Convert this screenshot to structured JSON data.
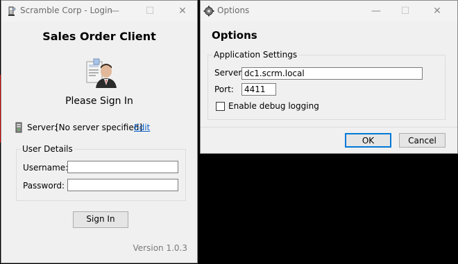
{
  "login": {
    "window_title": "Scramble Corp - Login",
    "app_title": "Sales Order Client",
    "prompt": "Please Sign In",
    "server_label": "Server:",
    "server_value": "[No server specified]",
    "edit_link": "Edit",
    "group_title": "User Details",
    "username_label": "Username:",
    "username_value": "",
    "password_label": "Password:",
    "password_value": "",
    "sign_in_button": "Sign In",
    "version": "Version 1.0.3"
  },
  "options": {
    "window_title": "Options",
    "heading": "Options",
    "group_title": "Application Settings",
    "server_label": "Server:",
    "server_value": "dc1.scrm.local",
    "port_label": "Port:",
    "port_value": "4411",
    "debug_label": "Enable debug logging",
    "debug_checked": false,
    "ok_button": "OK",
    "cancel_button": "Cancel"
  },
  "window_controls": {
    "minimize": "—",
    "maximize": "☐",
    "close": "✕"
  },
  "colors": {
    "link": "#0a5fc6",
    "window_bg": "#f0f0f0",
    "focus_border": "#0078d7"
  }
}
